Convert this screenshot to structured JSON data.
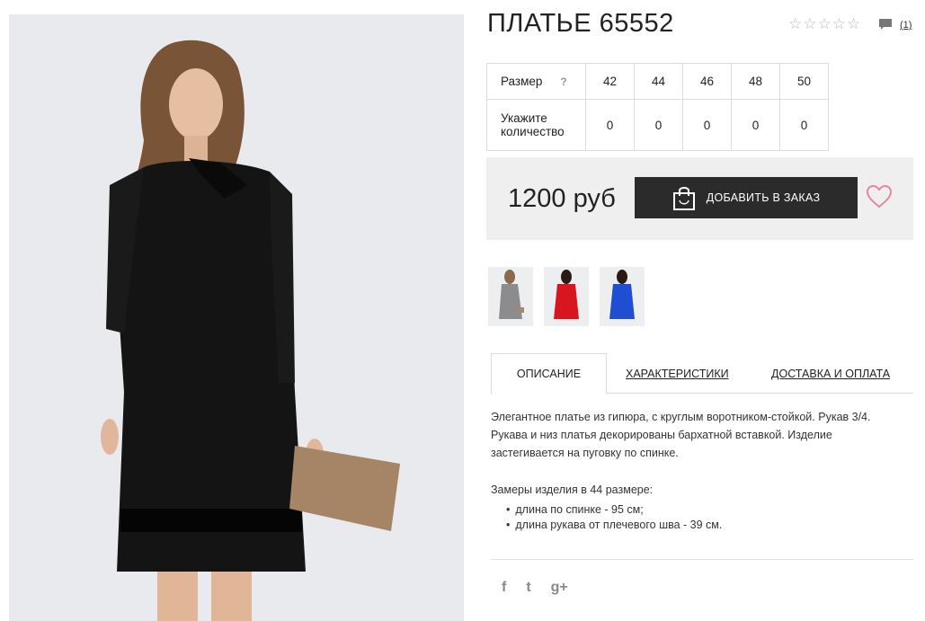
{
  "product": {
    "title": "ПЛАТЬЕ 65552",
    "rating_stars": 5,
    "rating_filled": 0,
    "comments_count": "(1)"
  },
  "size_table": {
    "size_label": "Размер",
    "help_mark": "?",
    "sizes": [
      "42",
      "44",
      "46",
      "48",
      "50"
    ],
    "quantity_label": "Укажите количество",
    "quantities": [
      "0",
      "0",
      "0",
      "0",
      "0"
    ]
  },
  "buy": {
    "price": "1200 руб",
    "add_button_label": "ДОБАВИТЬ В ЗАКАЗ"
  },
  "thumbnails": [
    {
      "color": "grey"
    },
    {
      "color": "red"
    },
    {
      "color": "blue"
    }
  ],
  "tabs": [
    {
      "label": "ОПИСАНИЕ",
      "active": true
    },
    {
      "label": "ХАРАКТЕРИСТИКИ",
      "active": false
    },
    {
      "label": "ДОСТАВКА И ОПЛАТА",
      "active": false
    }
  ],
  "description": {
    "text": "Элегантное платье из гипюра, с круглым воротником-стойкой. Рукав 3/4. Рукава и низ платья декорированы бархатной вставкой. Изделие застегивается на пуговку по спинке.",
    "measures_title": "Замеры изделия в 44 размере:",
    "measures": [
      "длина по спинке - 95 см;",
      "длина рукава от плечевого шва - 39 см."
    ]
  },
  "social": {
    "facebook": "f",
    "twitter": "t",
    "googleplus": "g+"
  },
  "colors": {
    "button_bg": "#2b2b2b",
    "heart": "#e0899c",
    "buy_box_bg": "#efefef"
  }
}
